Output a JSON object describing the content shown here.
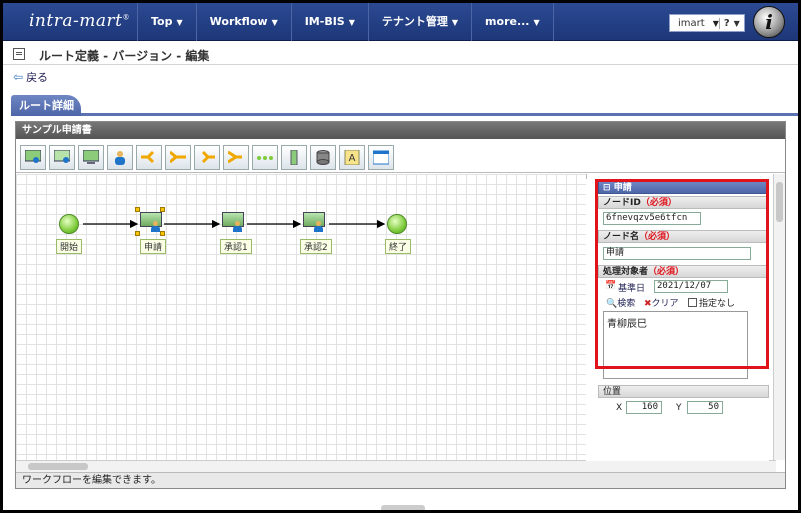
{
  "nav": {
    "logo": "intra-mart",
    "logo_mark": "®",
    "items": [
      {
        "label": "Top"
      },
      {
        "label": "Workflow"
      },
      {
        "label": "IM-BIS"
      },
      {
        "label": "テナント管理"
      },
      {
        "label": "more..."
      }
    ],
    "user": "imart",
    "help": "?",
    "globe_letter": "i"
  },
  "page": {
    "title": "ルート定義 - バージョン - 編集",
    "back": "戻る",
    "tab": "ルート詳細"
  },
  "panel": {
    "title": "サンプル申請書",
    "status": "ワークフローを編集できます。"
  },
  "toolbar": [
    "start-node-tool",
    "approve-node-tool",
    "system-node-tool",
    "user-node-tool",
    "branch-tool",
    "merge-tool",
    "split-tool",
    "join-tool",
    "dummy-node-tool",
    "vertical-tool",
    "database-tool",
    "text-tool",
    "window-tool"
  ],
  "nodes": [
    {
      "id": "start",
      "label": "開始",
      "type": "circle"
    },
    {
      "id": "apply",
      "label": "申請",
      "type": "monitor"
    },
    {
      "id": "approve1",
      "label": "承認1",
      "type": "monitor"
    },
    {
      "id": "approve2",
      "label": "承認2",
      "type": "monitor"
    },
    {
      "id": "end",
      "label": "終了",
      "type": "circle"
    }
  ],
  "props": {
    "section_title": "申請",
    "node_id_label": "ノードID",
    "node_id_value": "6fnevqzv5e6tfcn",
    "required": "（必須）",
    "node_name_label": "ノード名",
    "node_name_value": "申請",
    "target_label": "処理対象者",
    "base_date_label": "基準日",
    "base_date_value": "2021/12/07",
    "search": "検索",
    "clear": "クリア",
    "none": "指定なし",
    "assignee": "青柳辰巳",
    "position_label": "位置",
    "x_label": "X",
    "x_value": "160",
    "y_label": "Y",
    "y_value": "50"
  },
  "colors": {
    "accent": "#1d3778",
    "highlight": "#e0131b",
    "node_green": "#7fcc3c"
  }
}
